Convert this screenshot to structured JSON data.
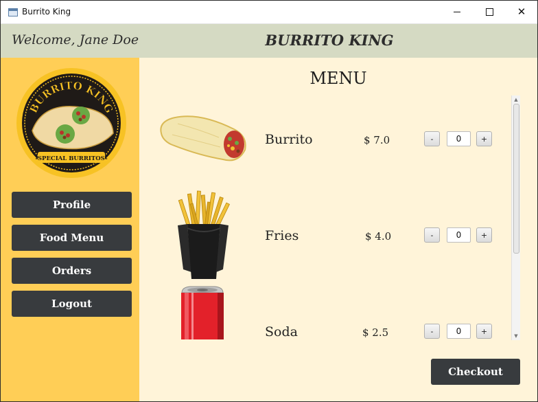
{
  "window": {
    "title": "Burrito King"
  },
  "header": {
    "welcome": "Welcome, Jane Doe",
    "brand": "BURRITO KING"
  },
  "logo": {
    "top_text": "BURRITO KING",
    "bottom_text": "-SPECIAL BURRITOS-"
  },
  "sidebar": {
    "items": [
      {
        "label": "Profile"
      },
      {
        "label": "Food Menu"
      },
      {
        "label": "Orders"
      },
      {
        "label": "Logout"
      }
    ]
  },
  "main": {
    "title": "MENU",
    "items": [
      {
        "name": "Burrito",
        "price": "$ 7.0",
        "qty": "0",
        "minus": "-",
        "plus": "+"
      },
      {
        "name": "Fries",
        "price": "$ 4.0",
        "qty": "0",
        "minus": "-",
        "plus": "+"
      },
      {
        "name": "Soda",
        "price": "$ 2.5",
        "qty": "0",
        "minus": "-",
        "plus": "+"
      }
    ],
    "checkout": "Checkout"
  },
  "colors": {
    "sidebar": "#ffce56",
    "header": "#d5dac3",
    "content": "#fff4d9",
    "button": "#383b3e"
  }
}
